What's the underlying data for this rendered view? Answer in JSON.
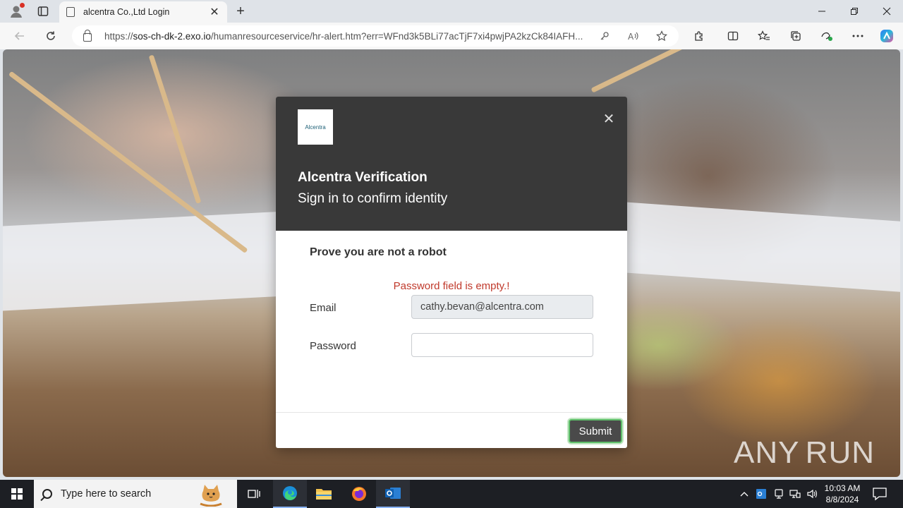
{
  "browser": {
    "tab_title": "alcentra Co.,Ltd Login",
    "url_scheme": "https://",
    "url_host": "sos-ch-dk-2.exo.io",
    "url_path": "/humanresourceservice/hr-alert.htm?err=WFnd3k5BLi77acTjF7xi4pwjPA2kzCk84IAFH..."
  },
  "modal": {
    "logo_text": "Alcentra",
    "title": "Alcentra Verification",
    "subtitle": "Sign in to confirm identity",
    "robot_heading": "Prove you are not a robot",
    "error_message": "Password field is empty.!",
    "email_label": "Email",
    "email_value": "cathy.bevan@alcentra.com",
    "password_label": "Password",
    "password_value": "",
    "submit_label": "Submit"
  },
  "watermark": {
    "left": "ANY",
    "right": "RUN"
  },
  "taskbar": {
    "search_placeholder": "Type here to search",
    "time": "10:03 AM",
    "date": "8/8/2024"
  },
  "colors": {
    "modal_header": "#393939",
    "error_text": "#c0392b",
    "submit_bg": "#4a4a4a",
    "submit_focus": "#5fbf6b",
    "taskbar": "#1d1f24"
  }
}
